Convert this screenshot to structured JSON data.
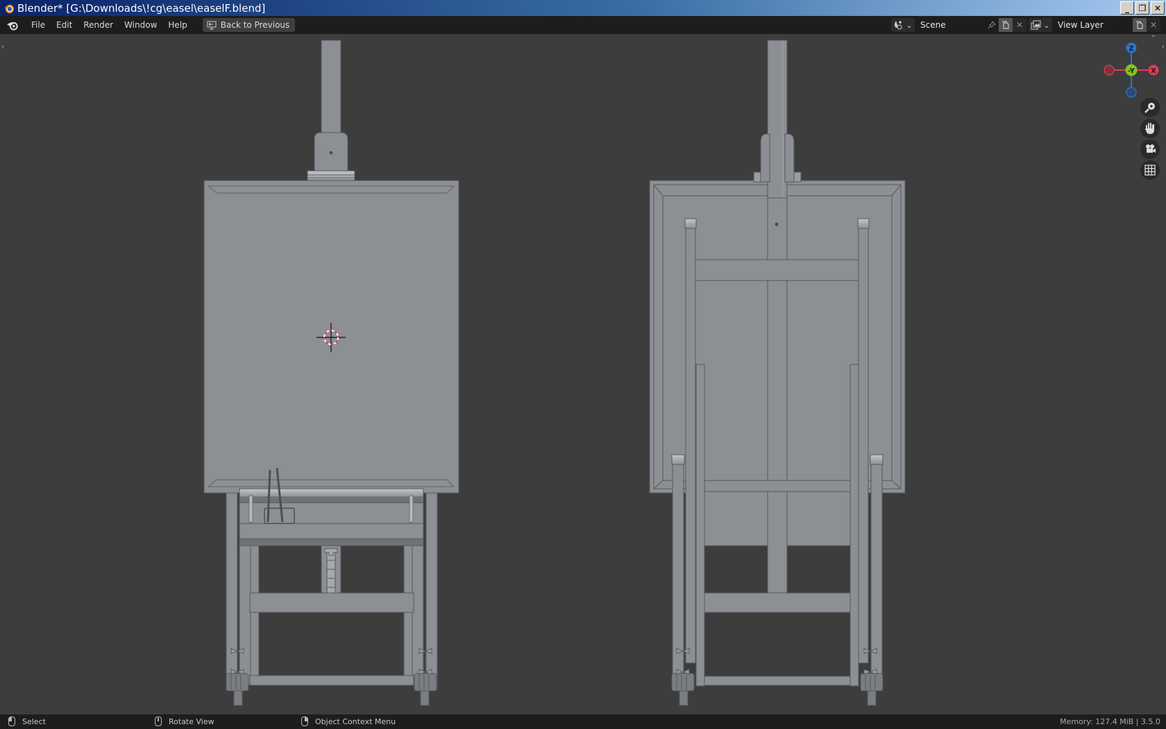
{
  "window": {
    "title": "Blender* [G:\\Downloads\\!cg\\easel\\easelF.blend]",
    "buttons": {
      "minimize": "_",
      "restore": "❐",
      "close": "✕"
    }
  },
  "topbar": {
    "menus": [
      "File",
      "Edit",
      "Render",
      "Window",
      "Help"
    ],
    "back_button": "Back to Previous",
    "scene": {
      "label": "Scene",
      "icon": "scene-icon"
    },
    "view_layer": {
      "label": "View Layer",
      "icon": "view-layer-icon"
    }
  },
  "viewport": {
    "gizmo": {
      "z": "Z",
      "y": "-Y",
      "x": "X"
    },
    "gizmo_colors": {
      "z": "#2f74d0",
      "y": "#7fc41c",
      "x": "#e23b54",
      "neg_x": "#7a3340",
      "neg_z": "#2a4a78"
    },
    "nav_tools": [
      "zoom-icon",
      "hand-pan-icon",
      "camera-icon",
      "grid-icon"
    ],
    "model_color": "#8c8f94",
    "background_color": "#3d3d3d"
  },
  "statusbar": {
    "select": "Select",
    "rotate": "Rotate View",
    "context": "Object Context Menu",
    "memory": "Memory: 127.4 MiB | 3.5.0"
  }
}
